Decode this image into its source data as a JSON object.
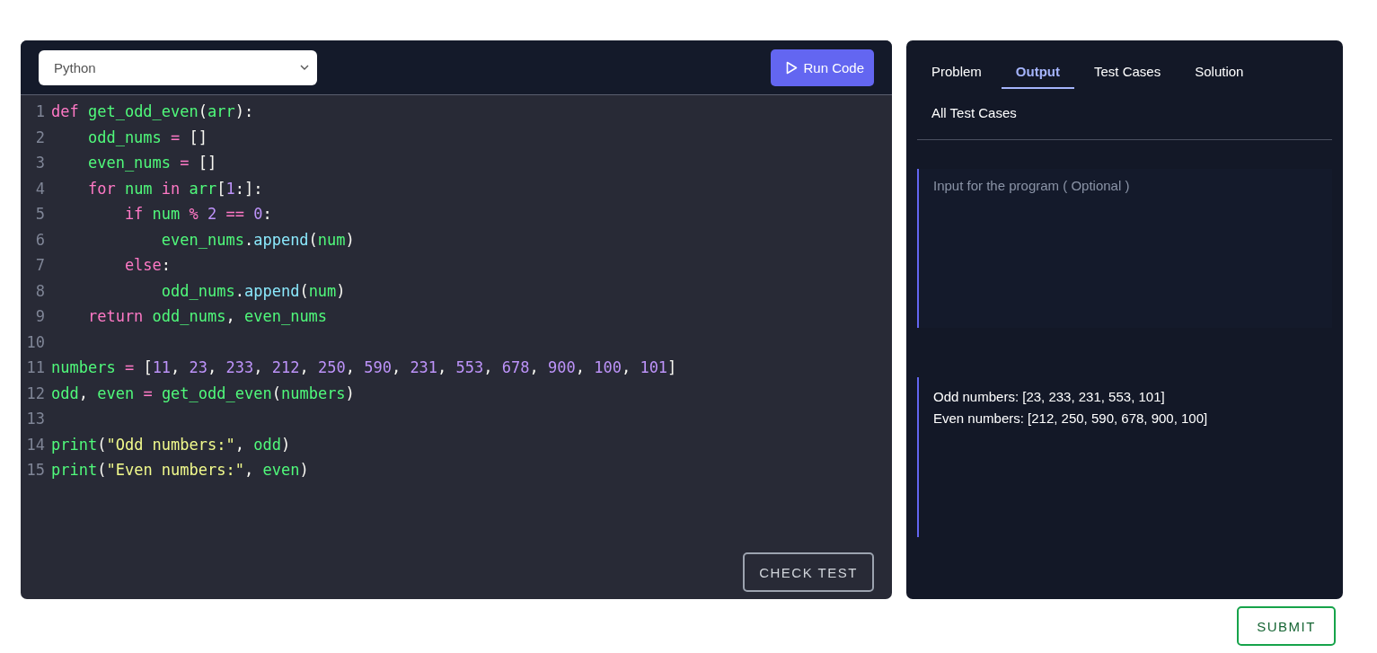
{
  "editor": {
    "language": "Python",
    "run_button": "Run Code",
    "check_button": "CHECK TEST",
    "lines": [
      {
        "number": "1",
        "tokens": [
          {
            "text": "def ",
            "kind": "keyword"
          },
          {
            "text": "get_odd_even",
            "kind": "name"
          },
          {
            "text": "(",
            "kind": "punct"
          },
          {
            "text": "arr",
            "kind": "name"
          },
          {
            "text": "):",
            "kind": "punct"
          }
        ]
      },
      {
        "number": "2",
        "tokens": [
          {
            "text": "    odd_nums ",
            "kind": "name"
          },
          {
            "text": "= ",
            "kind": "operator"
          },
          {
            "text": "[]",
            "kind": "punct"
          }
        ]
      },
      {
        "number": "3",
        "tokens": [
          {
            "text": "    even_nums ",
            "kind": "name"
          },
          {
            "text": "= ",
            "kind": "operator"
          },
          {
            "text": "[]",
            "kind": "punct"
          }
        ]
      },
      {
        "number": "4",
        "tokens": [
          {
            "text": "    for ",
            "kind": "keyword"
          },
          {
            "text": "num ",
            "kind": "name"
          },
          {
            "text": "in ",
            "kind": "keyword"
          },
          {
            "text": "arr",
            "kind": "name"
          },
          {
            "text": "[",
            "kind": "punct"
          },
          {
            "text": "1",
            "kind": "number"
          },
          {
            "text": ":]:",
            "kind": "punct"
          }
        ]
      },
      {
        "number": "5",
        "tokens": [
          {
            "text": "        if ",
            "kind": "keyword"
          },
          {
            "text": "num ",
            "kind": "name"
          },
          {
            "text": "% ",
            "kind": "operator"
          },
          {
            "text": "2 ",
            "kind": "number"
          },
          {
            "text": "== ",
            "kind": "operator"
          },
          {
            "text": "0",
            "kind": "number"
          },
          {
            "text": ":",
            "kind": "punct"
          }
        ]
      },
      {
        "number": "6",
        "tokens": [
          {
            "text": "            even_nums",
            "kind": "name"
          },
          {
            "text": ".",
            "kind": "punct"
          },
          {
            "text": "append",
            "kind": "method"
          },
          {
            "text": "(",
            "kind": "punct"
          },
          {
            "text": "num",
            "kind": "name"
          },
          {
            "text": ")",
            "kind": "punct"
          }
        ]
      },
      {
        "number": "7",
        "tokens": [
          {
            "text": "        else",
            "kind": "keyword"
          },
          {
            "text": ":",
            "kind": "punct"
          }
        ]
      },
      {
        "number": "8",
        "tokens": [
          {
            "text": "            odd_nums",
            "kind": "name"
          },
          {
            "text": ".",
            "kind": "punct"
          },
          {
            "text": "append",
            "kind": "method"
          },
          {
            "text": "(",
            "kind": "punct"
          },
          {
            "text": "num",
            "kind": "name"
          },
          {
            "text": ")",
            "kind": "punct"
          }
        ]
      },
      {
        "number": "9",
        "tokens": [
          {
            "text": "    return ",
            "kind": "keyword"
          },
          {
            "text": "odd_nums",
            "kind": "name"
          },
          {
            "text": ", ",
            "kind": "punct"
          },
          {
            "text": "even_nums",
            "kind": "name"
          }
        ]
      },
      {
        "number": "10"
      },
      {
        "number": "11",
        "tokens": [
          {
            "text": "numbers ",
            "kind": "name"
          },
          {
            "text": "= ",
            "kind": "operator"
          },
          {
            "text": "[",
            "kind": "punct"
          },
          {
            "text": "11",
            "kind": "number"
          },
          {
            "text": ", ",
            "kind": "punct"
          },
          {
            "text": "23",
            "kind": "number"
          },
          {
            "text": ", ",
            "kind": "punct"
          },
          {
            "text": "233",
            "kind": "number"
          },
          {
            "text": ", ",
            "kind": "punct"
          },
          {
            "text": "212",
            "kind": "number"
          },
          {
            "text": ", ",
            "kind": "punct"
          },
          {
            "text": "250",
            "kind": "number"
          },
          {
            "text": ", ",
            "kind": "punct"
          },
          {
            "text": "590",
            "kind": "number"
          },
          {
            "text": ", ",
            "kind": "punct"
          },
          {
            "text": "231",
            "kind": "number"
          },
          {
            "text": ", ",
            "kind": "punct"
          },
          {
            "text": "553",
            "kind": "number"
          },
          {
            "text": ", ",
            "kind": "punct"
          },
          {
            "text": "678",
            "kind": "number"
          },
          {
            "text": ", ",
            "kind": "punct"
          },
          {
            "text": "900",
            "kind": "number"
          },
          {
            "text": ", ",
            "kind": "punct"
          },
          {
            "text": "100",
            "kind": "number"
          },
          {
            "text": ", ",
            "kind": "punct"
          },
          {
            "text": "101",
            "kind": "number"
          },
          {
            "text": "]",
            "kind": "punct"
          }
        ]
      },
      {
        "number": "12",
        "tokens": [
          {
            "text": "odd",
            "kind": "name"
          },
          {
            "text": ", ",
            "kind": "punct"
          },
          {
            "text": "even ",
            "kind": "name"
          },
          {
            "text": "= ",
            "kind": "operator"
          },
          {
            "text": "get_odd_even",
            "kind": "name"
          },
          {
            "text": "(",
            "kind": "punct"
          },
          {
            "text": "numbers",
            "kind": "name"
          },
          {
            "text": ")",
            "kind": "punct"
          }
        ]
      },
      {
        "number": "13"
      },
      {
        "number": "14",
        "tokens": [
          {
            "text": "print",
            "kind": "name"
          },
          {
            "text": "(",
            "kind": "punct"
          },
          {
            "text": "\"Odd numbers:\"",
            "kind": "string"
          },
          {
            "text": ", ",
            "kind": "punct"
          },
          {
            "text": "odd",
            "kind": "name"
          },
          {
            "text": ")",
            "kind": "punct"
          }
        ]
      },
      {
        "number": "15",
        "tokens": [
          {
            "text": "print",
            "kind": "name"
          },
          {
            "text": "(",
            "kind": "punct"
          },
          {
            "text": "\"Even numbers:\"",
            "kind": "string"
          },
          {
            "text": ", ",
            "kind": "punct"
          },
          {
            "text": "even",
            "kind": "name"
          },
          {
            "text": ")",
            "kind": "punct"
          }
        ]
      }
    ]
  },
  "panel": {
    "tabs": [
      {
        "label": "Problem",
        "selected": false
      },
      {
        "label": "Output",
        "selected": true
      },
      {
        "label": "Test Cases",
        "selected": false
      },
      {
        "label": "Solution",
        "selected": false
      },
      {
        "label": "All Test Cases",
        "selected": false
      }
    ],
    "input": {
      "placeholder": "Input for the program ( Optional )"
    },
    "output": [
      "Odd numbers: [23, 233, 231, 553, 101]",
      "Even numbers: [212, 250, 590, 678, 900, 100]"
    ]
  },
  "submit_button": "SUBMIT"
}
